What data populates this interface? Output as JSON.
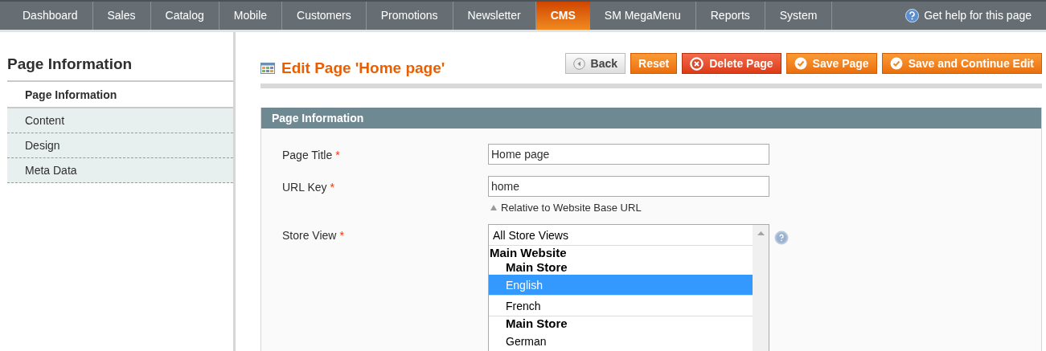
{
  "nav": {
    "items": [
      {
        "label": "Dashboard",
        "selected": false
      },
      {
        "label": "Sales",
        "selected": false
      },
      {
        "label": "Catalog",
        "selected": false
      },
      {
        "label": "Mobile",
        "selected": false
      },
      {
        "label": "Customers",
        "selected": false
      },
      {
        "label": "Promotions",
        "selected": false
      },
      {
        "label": "Newsletter",
        "selected": false
      },
      {
        "label": "CMS",
        "selected": true
      },
      {
        "label": "SM MegaMenu",
        "selected": false
      },
      {
        "label": "Reports",
        "selected": false
      },
      {
        "label": "System",
        "selected": false
      }
    ],
    "help": "Get help for this page"
  },
  "sidebar": {
    "title": "Page Information",
    "tabs": [
      {
        "label": "Page Information",
        "selected": true
      },
      {
        "label": "Content",
        "selected": false
      },
      {
        "label": "Design",
        "selected": false
      },
      {
        "label": "Meta Data",
        "selected": false
      }
    ]
  },
  "header": {
    "title": "Edit Page 'Home page'",
    "buttons": [
      {
        "kind": "back",
        "label": "Back"
      },
      {
        "kind": "plain",
        "label": "Reset"
      },
      {
        "kind": "delete",
        "label": "Delete Page"
      },
      {
        "kind": "save",
        "label": "Save Page"
      },
      {
        "kind": "save",
        "label": "Save and Continue Edit"
      }
    ]
  },
  "section": {
    "title": "Page Information",
    "fields": [
      {
        "kind": "text",
        "label": "Page Title",
        "required_mark": "*",
        "value": "Home page"
      },
      {
        "kind": "text",
        "label": "URL Key",
        "required_mark": "*",
        "value": "home",
        "note": "Relative to Website Base URL"
      },
      {
        "kind": "multiselect",
        "label": "Store View",
        "required_mark": "*",
        "options": [
          {
            "kind": "option",
            "label": "All Store Views",
            "selected": false
          },
          {
            "kind": "group",
            "label": "Main Website",
            "children": [
              {
                "kind": "group",
                "label": "Main Store",
                "children": [
                  {
                    "kind": "option",
                    "label": "English",
                    "selected": true
                  },
                  {
                    "kind": "option",
                    "label": "French",
                    "selected": false
                  }
                ]
              },
              {
                "kind": "group",
                "label": "Main Store",
                "children": [
                  {
                    "kind": "option",
                    "label": "German",
                    "selected": false
                  }
                ]
              }
            ]
          }
        ]
      }
    ]
  }
}
